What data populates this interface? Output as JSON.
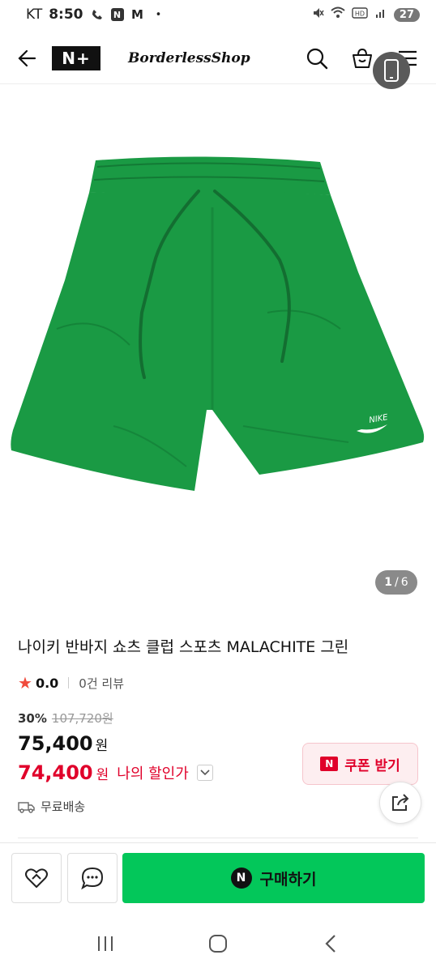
{
  "status_bar": {
    "carrier": "KT",
    "time": "8:50",
    "notif_n": "N",
    "notif_m": "M",
    "dot": "•",
    "battery": "27"
  },
  "header": {
    "logo": "N+",
    "shop_name": "BorderlessShop"
  },
  "gallery": {
    "current": "1",
    "separator": "/",
    "total": "6"
  },
  "product": {
    "title": "나이키 반바지 쇼츠 클럽 스포츠 MALACHITE 그린",
    "rating": "0.0",
    "review_count": "0건 리뷰",
    "discount_rate": "30%",
    "original_price": "107,720원",
    "price": "75,400",
    "price_unit": "원",
    "my_price": "74,400",
    "my_price_unit": "원",
    "my_price_label": "나의 할인가",
    "shipping": "무료배송",
    "image_brand_text": "NIKE"
  },
  "coupon": {
    "badge": "N",
    "label": "쿠폰 받기"
  },
  "bottom_bar": {
    "buy_badge": "N",
    "buy_label": "구매하기"
  },
  "colors": {
    "accent_red": "#e0002a",
    "buy_green": "#03c75a",
    "shorts_green": "#1a9a44",
    "star": "#f04b3c"
  },
  "icons": {
    "back": "arrow-left-icon",
    "search": "search-icon",
    "cart": "shopping-bag-icon",
    "menu": "hamburger-menu-icon",
    "phone": "phone-icon",
    "share": "share-icon",
    "wish": "heart-icon",
    "talk": "chat-icon",
    "shipping": "truck-icon"
  }
}
